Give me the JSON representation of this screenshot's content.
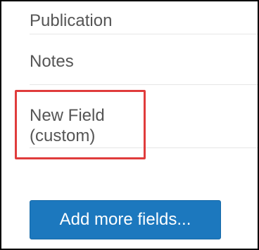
{
  "fields": [
    {
      "label": "Publication"
    },
    {
      "label": "Notes"
    }
  ],
  "custom_field": {
    "line1": "New Field",
    "line2": "(custom)"
  },
  "actions": {
    "add_more_label": "Add more fields..."
  },
  "colors": {
    "accent": "#1c78be",
    "highlight": "#e03c3c",
    "text": "#555555"
  }
}
